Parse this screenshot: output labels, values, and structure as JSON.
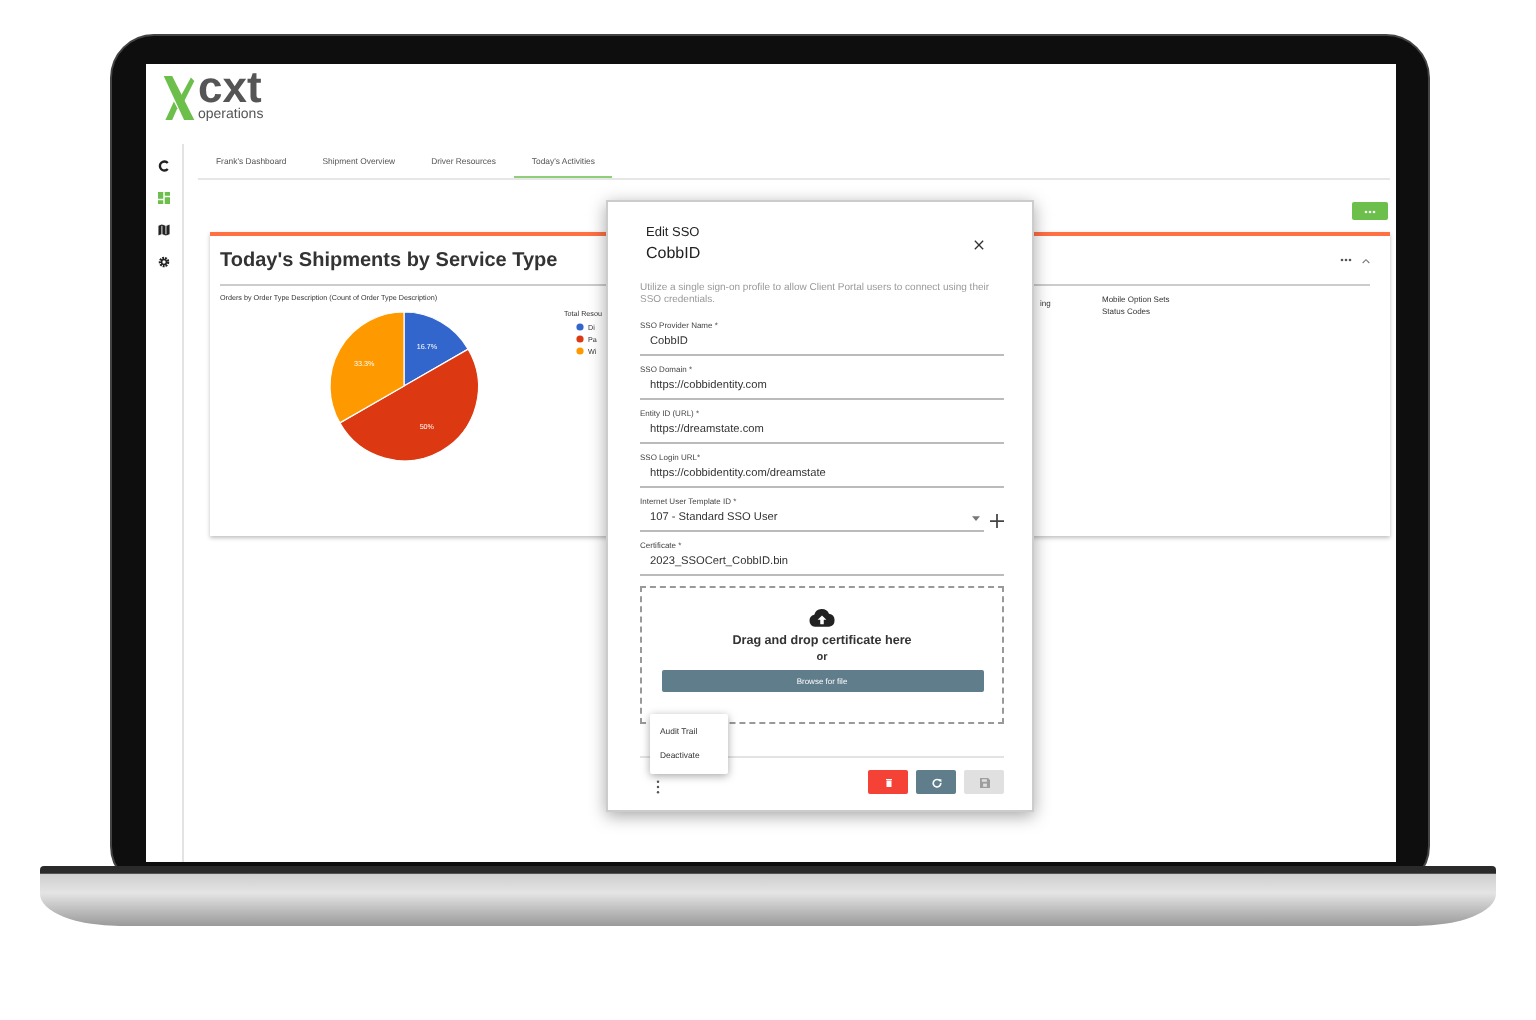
{
  "logo": {
    "wordmark": "cxt",
    "tagline": "operations"
  },
  "sidebar": [
    {
      "kind": "arc",
      "selected": false
    },
    {
      "kind": "dashboard",
      "selected": true
    },
    {
      "kind": "map",
      "selected": false
    },
    {
      "kind": "settings",
      "selected": false
    }
  ],
  "tabs": [
    {
      "label": "Frank's Dashboard",
      "selected": false
    },
    {
      "label": "Shipment Overview",
      "selected": false
    },
    {
      "label": "Driver Resources",
      "selected": false
    },
    {
      "label": "Today's Activities",
      "selected": true
    }
  ],
  "card": {
    "title": "Today's Shipments by Service Type",
    "chart_data": {
      "type": "pie",
      "legend": {
        "title": "Total Resou"
      },
      "title": "Orders by Order Type Description (Count of Order Type Description)",
      "categories": [
        "Di",
        "Pa",
        "Wi"
      ],
      "values": [
        16.7,
        50,
        33.3
      ],
      "value_labels": [
        "16.7%",
        "50%",
        "33.3%"
      ],
      "data_labels": true
    },
    "side_texts": [
      {
        "lines": [
          "ing"
        ]
      },
      {
        "lines": [
          "Mobile Option Sets",
          "Status Codes"
        ]
      }
    ]
  },
  "dialog": {
    "title": "Edit SSO",
    "subtitle": "CobbID",
    "description": "Utilize a single sign-on profile to allow Client Portal users to connect using their SSO credentials.",
    "fields": [
      {
        "kind": "text",
        "label": "SSO Provider Name *",
        "value": "CobbID"
      },
      {
        "kind": "text",
        "label": "SSO Domain *",
        "value": "https://cobbidentity.com"
      },
      {
        "kind": "text",
        "label": "Entity ID (URL) *",
        "value": "https://dreamstate.com"
      },
      {
        "kind": "text",
        "label": "SSO Login URL*",
        "value": "https://cobbidentity.com/dreamstate"
      },
      {
        "kind": "select",
        "label": "Internet User Template ID *",
        "value": "107 - Standard SSO User"
      },
      {
        "kind": "text",
        "label": "Certificate *",
        "value": "2023_SSOCert_CobbID.bin"
      }
    ],
    "dropzone": {
      "text": "Drag and drop certificate here",
      "or": "or",
      "button": "Browse for file"
    },
    "menu": [
      "Audit Trail",
      "Deactivate"
    ],
    "actions": [
      {
        "kind": "delete",
        "disabled": false
      },
      {
        "kind": "reset",
        "disabled": false
      },
      {
        "kind": "save",
        "disabled": true
      }
    ]
  }
}
